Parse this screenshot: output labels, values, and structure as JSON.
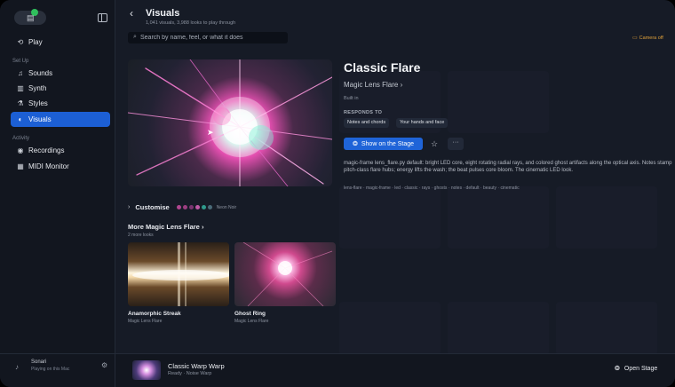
{
  "sidebar": {
    "nav_top": [
      {
        "label": "Play",
        "icon": "play-icon"
      }
    ],
    "setup_label": "Set Up",
    "setup_items": [
      {
        "label": "Sounds",
        "icon": "music-notes-icon"
      },
      {
        "label": "Synth",
        "icon": "piano-keys-icon"
      },
      {
        "label": "Styles",
        "icon": "styles-icon"
      },
      {
        "label": "Visuals",
        "icon": "visuals-icon",
        "active": true
      }
    ],
    "activity_label": "Activity",
    "activity_items": [
      {
        "label": "Recordings",
        "icon": "record-icon"
      },
      {
        "label": "MIDI Monitor",
        "icon": "midi-icon"
      }
    ],
    "footer": {
      "title": "Sonari",
      "subtitle": "Playing on this Mac"
    }
  },
  "header": {
    "title": "Visuals",
    "subtitle": "1,041 visuals, 3,988 looks to play through",
    "search_placeholder": "Search by name, feel, or what it does",
    "camera_status": "Camera off"
  },
  "detail": {
    "title": "Classic Flare",
    "family": "Magic Lens Flare",
    "origin": "Built in",
    "responds_label": "RESPONDS TO",
    "responds_to": [
      "Notes and chords",
      "Your hands and face"
    ],
    "show_button": "Show on the Stage",
    "description": "magic-frame lens_flare.py default: bright LED core, eight rotating radial rays, and colored ghost artifacts along the optical axis. Notes stamp pitch-class flare hubs; energy lifts the wash; the beat pulses core bloom. The cinematic LED look.",
    "tags": "lens-flare · magic-frame · led · classic · rays · ghosts · notes · default · beauty · cinematic"
  },
  "customise": {
    "label": "Customise",
    "palette_name": "Neon Noir",
    "swatches": [
      "#b0468f",
      "#9b3e80",
      "#7a3470",
      "#c05aa6",
      "#2f9a8c",
      "#4a6a78"
    ]
  },
  "more": {
    "title": "More Magic Lens Flare",
    "subtitle": "2 more looks",
    "cards": [
      {
        "name": "Anamorphic Streak",
        "family": "Magic Lens Flare"
      },
      {
        "name": "Ghost Ring",
        "family": "Magic Lens Flare"
      }
    ]
  },
  "now_playing": {
    "title": "Classic Warp Warp",
    "subtitle": "Ready · Noise Warp",
    "open_stage": "Open Stage"
  }
}
